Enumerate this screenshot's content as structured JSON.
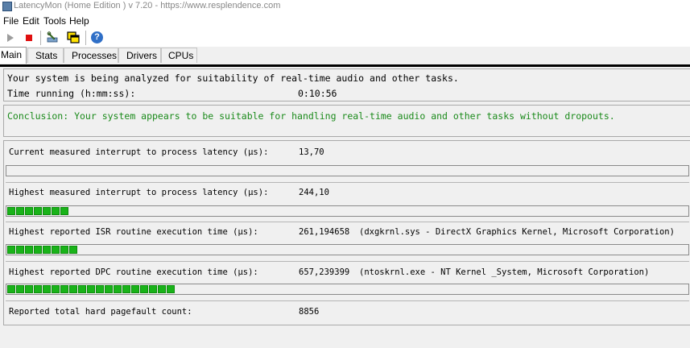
{
  "window": {
    "title": "LatencyMon  (Home Edition )  v 7.20 - https://www.resplendence.com"
  },
  "menu": [
    "File",
    "Edit",
    "Tools",
    "Help"
  ],
  "toolbar": {
    "icons": [
      "play-icon",
      "stop-icon",
      "wrench-icon",
      "windows-icon",
      "help-icon"
    ],
    "help_glyph": "?"
  },
  "tabs": [
    "Main",
    "Stats",
    "Processes",
    "Drivers",
    "CPUs"
  ],
  "status": {
    "analyzing": "Your system is being analyzed for suitability of real-time audio and other tasks.",
    "time_label": "Time running (h:mm:ss):",
    "time_value": "0:10:56"
  },
  "conclusion": "Conclusion: Your system appears to be suitable for handling real-time audio and other tasks without dropouts.",
  "colors": {
    "conclusion_text": "#1a8a1a",
    "bar_green": "#19b319"
  },
  "metrics": [
    {
      "label": "Current measured interrupt to process latency (µs):",
      "value": "13,70",
      "detail": "",
      "bar_level": 0.0
    },
    {
      "label": "Highest measured interrupt to process latency (µs):",
      "value": "244,10",
      "detail": "",
      "bar_level": 0.085
    },
    {
      "label": "Highest reported ISR routine execution time (µs):",
      "value": "261,194658",
      "detail": "(dxgkrnl.sys - DirectX Graphics Kernel, Microsoft Corporation)",
      "bar_level": 0.1
    },
    {
      "label": "Highest reported DPC routine execution time (µs):",
      "value": "657,239399",
      "detail": "(ntoskrnl.exe - NT Kernel _System, Microsoft Corporation)",
      "bar_level": 0.245
    }
  ],
  "pagefault": {
    "label": "Reported total hard pagefault count:",
    "value": "8856"
  }
}
